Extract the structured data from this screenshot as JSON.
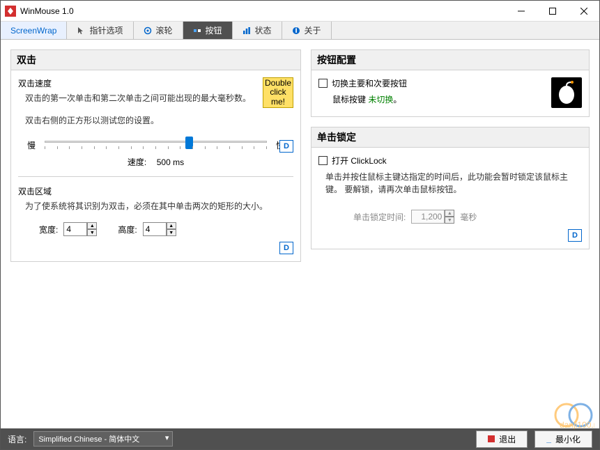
{
  "window": {
    "title": "WinMouse 1.0"
  },
  "tabs": {
    "screenwrap": "ScreenWrap",
    "pointer": "指针选项",
    "wheel": "滚轮",
    "buttons": "按钮",
    "status": "状态",
    "about": "关于"
  },
  "dblclick": {
    "title": "双击",
    "speed_hdr": "双击速度",
    "speed_desc": "双击的第一次单击和第二次单击之间可能出现的最大毫秒数。",
    "test_hint": "双击右侧的正方形以测试您的设置。",
    "test_line1": "Double",
    "test_line2": "click",
    "test_line3": "me!",
    "slow": "慢",
    "fast": "快",
    "speed_label": "速度:",
    "speed_value": "500 ms",
    "area_hdr": "双击区域",
    "area_desc": "为了使系统将其识别为双击，必须在其中单击两次的矩形的大小。",
    "width_lbl": "宽度:",
    "width_val": "4",
    "height_lbl": "高度:",
    "height_val": "4",
    "d": "D"
  },
  "btncfg": {
    "title": "按钮配置",
    "swap": "切换主要和次要按钮",
    "status_prefix": "鼠标按键 ",
    "status_value": "未切换",
    "status_suffix": "。"
  },
  "clicklock": {
    "title": "单击锁定",
    "open": "打开 ClickLock",
    "desc": "单击并按住鼠标主键达指定的时间后，此功能会暂时锁定该鼠标主键。 要解锁，请再次单击鼠标按钮。",
    "time_lbl": "单击锁定时间:",
    "time_val": "1,200",
    "ms": "毫秒",
    "d": "D"
  },
  "footer": {
    "lang_lbl": "语言:",
    "lang_val": "Simplified Chinese  -  简体中文",
    "exit": "退出",
    "minimize": "最小化"
  }
}
